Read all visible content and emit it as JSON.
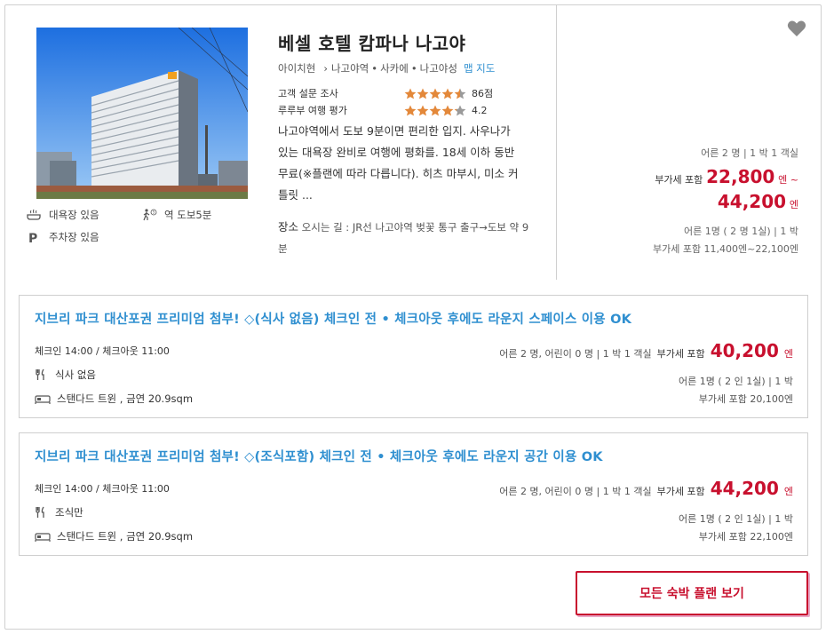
{
  "hotel": {
    "name": "베셀 호텔 캄파나 나고야",
    "location": {
      "prefecture": "아이치현",
      "area_arrow": "›",
      "areas": [
        "나고야역",
        "사카에",
        "나고야성"
      ],
      "map_link": "맵 지도"
    },
    "ratings": [
      {
        "label": "고객 설문 조사",
        "stars": 4.5,
        "value": "86점"
      },
      {
        "label": "루루부 여행 평가",
        "stars": 4.2,
        "value": "4.2"
      }
    ],
    "description": "나고야역에서 도보 9분이면 편리한 입지. 사우나가 있는 대욕장 완비로 여행에 평화를. 18세 이하 동반 무료(※플랜에 따라 다릅니다). 히츠 마부시, 미소 커틀릿 ...",
    "access_label": "장소",
    "access_text": "오시는 길 : JR선 나고야역 벚꽃 통구 출구→도보 약 9분",
    "amenities": [
      {
        "icon": "bath-icon",
        "label": "대욕장 있음"
      },
      {
        "icon": "walk-icon",
        "label": "역 도보5분"
      },
      {
        "icon": "parking-icon",
        "label": "주차장 있음"
      }
    ],
    "favorite_icon": "heart-icon"
  },
  "price_summary": {
    "occupancy": "어른 2 명 | 1 박 1 객실",
    "tax_label": "부가세 포함",
    "min_price": "22,800",
    "min_unit": "엔 ~",
    "max_price": "44,200",
    "max_unit": "엔",
    "per_person": "어른 1명 ( 2 명 1실) | 1 박",
    "per_person_range": "부가세 포함 11,400엔~22,100엔"
  },
  "plans": [
    {
      "title": "지브리 파크 대산포권 프리미엄 첨부! ◇(식사 없음) 체크인 전 • 체크아웃 후에도 라운지 스페이스 이용",
      "ok": "OK",
      "checkin": "체크인 14:00 / 체크아웃 11:00",
      "meal": "식사 없음",
      "room": "스탠다드 트윈 , 금연 20.9sqm",
      "occupancy": "어른 2 명, 어린이 0 명 | 1 박 1 객실",
      "tax_label": "부가세 포함",
      "price": "40,200",
      "unit": "엔",
      "per_person": "어른 1명 ( 2 인 1실) | 1 박",
      "per_person_price": "부가세 포함 20,100엔"
    },
    {
      "title": "지브리 파크 대산포권 프리미엄 첨부! ◇(조식포함) 체크인 전 • 체크아웃 후에도 라운지 공간 이용",
      "ok": "OK",
      "checkin": "체크인 14:00 / 체크아웃 11:00",
      "meal": "조식만",
      "room": "스탠다드 트윈 , 금연 20.9sqm",
      "occupancy": "어른 2 명, 어린이 0 명 | 1 박 1 객실",
      "tax_label": "부가세 포함",
      "price": "44,200",
      "unit": "엔",
      "per_person": "어른 1명 ( 2 인 1실) | 1 박",
      "per_person_price": "부가세 포함 22,100엔"
    }
  ],
  "all_plans_button": "모든 숙박 플랜 보기",
  "colors": {
    "accent_red": "#c8102e",
    "link_blue": "#2f8fd0",
    "star": "#e3883a"
  }
}
